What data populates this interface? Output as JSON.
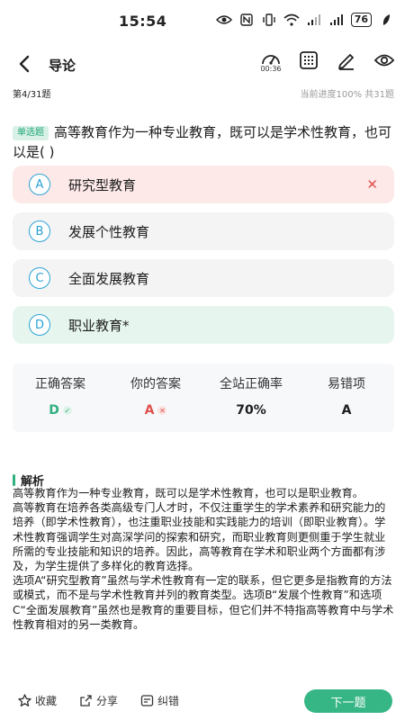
{
  "status": {
    "time": "15:54",
    "battery": "76"
  },
  "header": {
    "title": "导论",
    "timer": "00:36"
  },
  "progress": {
    "question_number": "第4/31题",
    "progress_text": "当前进度100%",
    "total": "共31题"
  },
  "question": {
    "type_tag": "单选题",
    "text": "高等教育作为一种专业教育，既可以是学术性教育，也可以是(    )"
  },
  "options": [
    {
      "letter": "A",
      "text": "研究型教育",
      "state": "wrong"
    },
    {
      "letter": "B",
      "text": "发展个性教育",
      "state": "normal"
    },
    {
      "letter": "C",
      "text": "全面发展教育",
      "state": "normal"
    },
    {
      "letter": "D",
      "text": "职业教育*",
      "state": "correct"
    }
  ],
  "stats": {
    "labels": [
      "正确答案",
      "你的答案",
      "全站正确率",
      "易错项"
    ],
    "correct_answer": "D",
    "your_answer": "A",
    "accuracy": "70%",
    "common_mistake": "A"
  },
  "analysis": {
    "title": "解析",
    "paragraphs": [
      "高等教育作为一种专业教育，既可以是学术性教育，也可以是职业教育。",
      "高等教育在培养各类高级专门人才时，不仅注重学生的学术素养和研究能力的培养（即学术性教育），也注重职业技能和实践能力的培训（即职业教育）。学术性教育强调学生对高深学问的探索和研究，而职业教育则更侧重于学生就业所需的专业技能和知识的培养。因此，高等教育在学术和职业两个方面都有涉及，为学生提供了多样化的教育选择。",
      "选项A“研究型教育”虽然与学术性教育有一定的联系，但它更多是指教育的方法或模式，而不是与学术性教育并列的教育类型。选项B“发展个性教育”和选项C“全面发展教育”虽然也是教育的重要目标，但它们并不特指高等教育中与学术性教育相对的另一类教育。"
    ]
  },
  "bottom": {
    "favorite": "收藏",
    "share": "分享",
    "correction": "纠错",
    "next": "下一题"
  },
  "colors": {
    "accent": "#36b585",
    "wrong_bg": "#fde9e8",
    "correct_bg": "#e6f6ee",
    "option_letter": "#2aa2d6",
    "wrong": "#e0524f"
  }
}
